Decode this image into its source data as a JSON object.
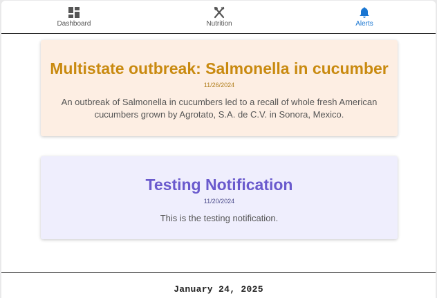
{
  "nav": {
    "items": [
      {
        "label": "Dashboard",
        "icon": "dashboard-icon"
      },
      {
        "label": "Nutrition",
        "icon": "utensils-icon"
      },
      {
        "label": "Alerts",
        "icon": "bell-icon",
        "active": true
      }
    ],
    "active_color": "#1976d2"
  },
  "alerts": [
    {
      "title": "Multistate outbreak: Salmonella in cucumber",
      "date": "11/26/2024",
      "body": "An outbreak of Salmonella in cucumbers led to a recall of whole fresh American cucumbers grown by Agrotato, S.A. de C.V. in Sonora, Mexico.",
      "title_color": "#c98a10",
      "background": "#fdeee3"
    },
    {
      "title": "Testing Notification",
      "date": "11/20/2024",
      "body": "This is the testing notification.",
      "title_color": "#6a5acd",
      "background": "#efeefd"
    }
  ],
  "footer": {
    "date": "January 24, 2025"
  }
}
